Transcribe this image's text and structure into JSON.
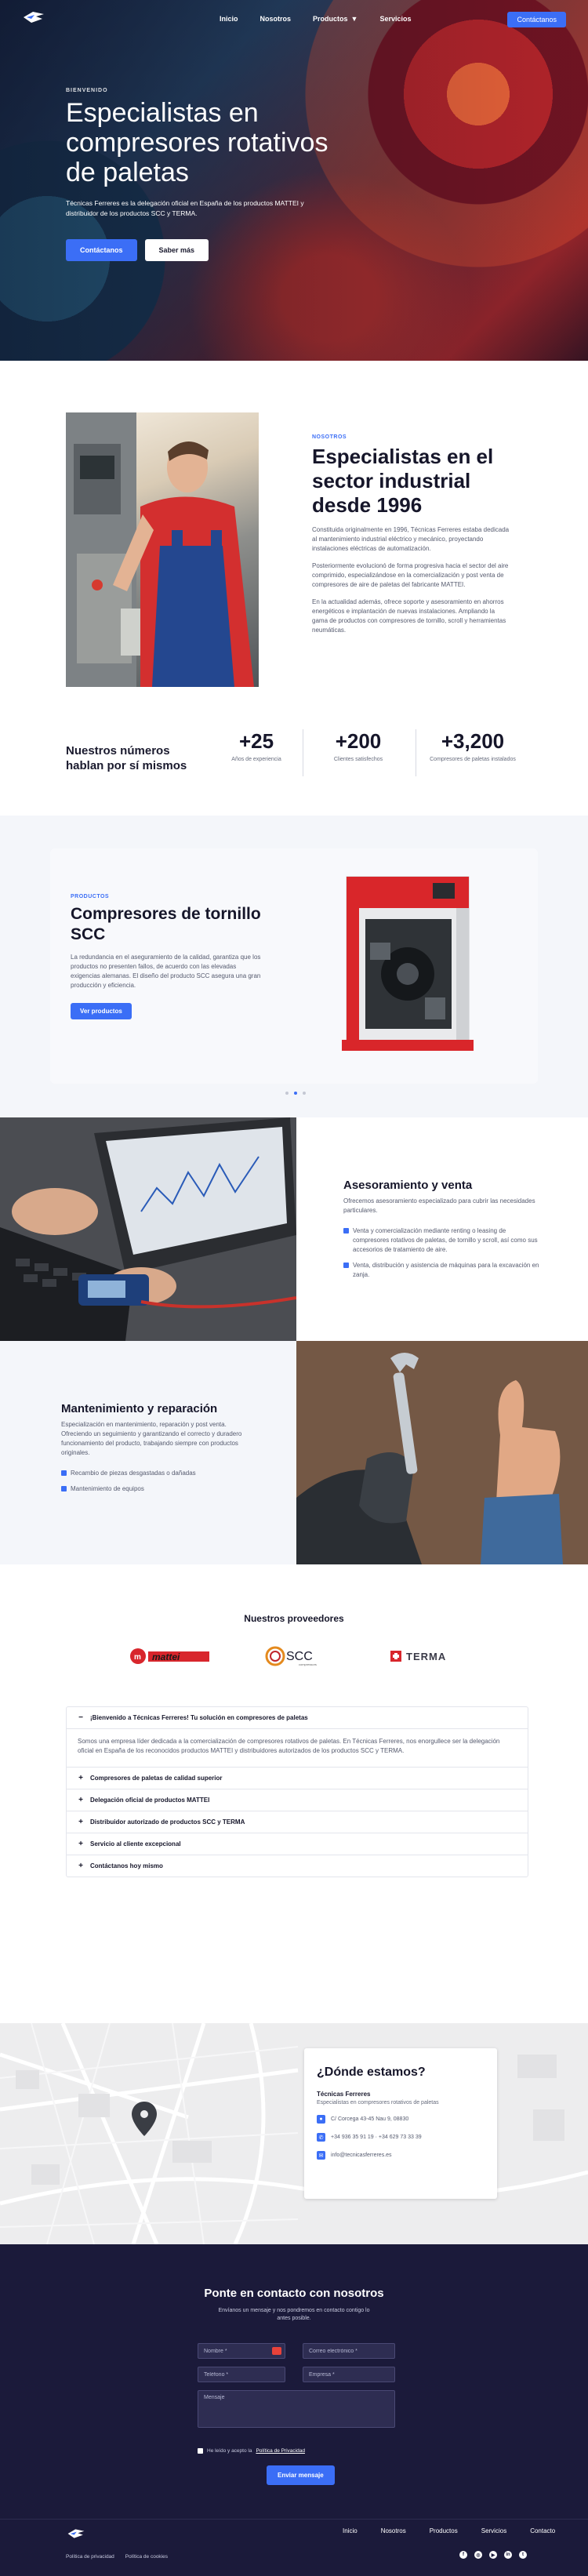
{
  "nav": {
    "links": [
      "Inicio",
      "Nosotros",
      "Productos",
      "Servicios"
    ],
    "cta": "Contáctanos"
  },
  "hero": {
    "eyebrow": "BIENVENIDO",
    "title": "Especialistas en compresores rotativos de paletas",
    "description": "Técnicas Ferreres es la delegación oficial en España de los productos MATTEI y distribuidor de los productos SCC y TERMA.",
    "primary_btn": "Contáctanos",
    "secondary_btn": "Saber más"
  },
  "about": {
    "eyebrow": "NOSOTROS",
    "title": "Especialistas en el sector industrial desde 1996",
    "p1": "Constituida originalmente en 1996, Técnicas Ferreres estaba dedicada al mantenimiento industrial eléctrico y mecánico, proyectando instalaciones eléctricas de automatización.",
    "p2": "Posteriormente evolucionó de forma progresiva hacia el sector del aire comprimido, especializándose en la comercialización y post venta de compresores de aire de paletas del fabricante MATTEI.",
    "p3": "En la actualidad además, ofrece soporte y asesoramiento en ahorros energéticos e implantación de nuevas instalaciones. Ampliando la gama de productos con compresores de tornillo, scroll y herramientas neumáticas."
  },
  "stats": {
    "title": "Nuestros números hablan por sí mismos",
    "items": [
      {
        "value": "+25",
        "label": "Años de experiencia"
      },
      {
        "value": "+200",
        "label": "Clientes satisfechos"
      },
      {
        "value": "+3,200",
        "label": "Compresores de paletas instalados"
      }
    ]
  },
  "products": {
    "eyebrow": "PRODUCTOS",
    "title": "Compresores de tornillo SCC",
    "description": "La redundancia en el aseguramiento de la calidad, garantiza que los productos no presenten fallos, de acuerdo con las elevadas exigencias alemanas. El diseño del producto SCC asegura una gran producción y eficiencia.",
    "button": "Ver productos",
    "slides": 3,
    "active_slide": 1
  },
  "services": [
    {
      "title": "Asesoramiento y venta",
      "description": "Ofrecemos asesoramiento especializado para cubrir las necesidades particulares.",
      "bullets": [
        "Venta y comercialización mediante renting o leasing de compresores rotativos de paletas, de tornillo y scroll, así como sus accesorios de tratamiento de aire.",
        "Venta, distribución y asistencia de máquinas para la excavación en zanja."
      ]
    },
    {
      "title": "Mantenimiento y reparación",
      "description": "Especialización en mantenimiento, reparación y post venta. Ofreciendo un seguimiento y garantizando el correcto y duradero funcionamiento del producto, trabajando siempre con productos originales.",
      "bullets": [
        "Recambio de piezas desgastadas o dañadas",
        "Mantenimiento de equipos"
      ]
    }
  ],
  "providers": {
    "title": "Nuestros proveedores",
    "logos": [
      "mattei",
      "SCC",
      "TERMA"
    ],
    "scc_tagline": "compressors"
  },
  "faq": {
    "open_question": "¡Bienvenido a Técnicas Ferreres! Tu solución en compresores de paletas",
    "open_answer": "Somos una empresa líder dedicada a la comercialización de compresores rotativos de paletas. En Técnicas Ferreres, nos enorgullece ser la delegación oficial en España de los reconocidos productos MATTEI y distribuidores autorizados de los productos SCC y TERMA.",
    "questions": [
      "Compresores de paletas de calidad superior",
      "Delegación oficial de productos MATTEI",
      "Distribuidor autorizado de productos SCC y TERMA",
      "Servicio al cliente excepcional",
      "Contáctanos hoy mismo"
    ]
  },
  "location": {
    "title": "¿Dónde estamos?",
    "company": "Técnicas Ferreres",
    "tagline": "Especialistas en compresores rotativos de paletas",
    "address": "C/ Corcega 43-45 Nau 9, 08830",
    "phone": "+34 936 35 91 19 · +34 629 73 33 39",
    "email": "info@tecnicasferreres.es"
  },
  "contact": {
    "title": "Ponte en contacto con nosotros",
    "subtitle": "Envíanos un mensaje y nos pondremos en contacto contigo lo antes posible.",
    "name_placeholder": "Nombre *",
    "email_placeholder": "Correo electrónico *",
    "phone_placeholder": "Teléfono *",
    "company_placeholder": "Empresa *",
    "message_placeholder": "Mensaje",
    "consent": "He leído y acepto la",
    "privacy_link": "Política de Privacidad",
    "send": "Enviar mensaje"
  },
  "footer": {
    "links": [
      "Inicio",
      "Nosotros",
      "Productos",
      "Servicios",
      "Contacto"
    ],
    "legal": [
      "Política de privacidad",
      "Política de cookies"
    ],
    "social": [
      "facebook-icon",
      "instagram-icon",
      "youtube-icon",
      "linkedin-icon",
      "twitter-icon"
    ]
  },
  "colors": {
    "accent": "#3b6ef6",
    "dark": "#1b1a3a"
  }
}
